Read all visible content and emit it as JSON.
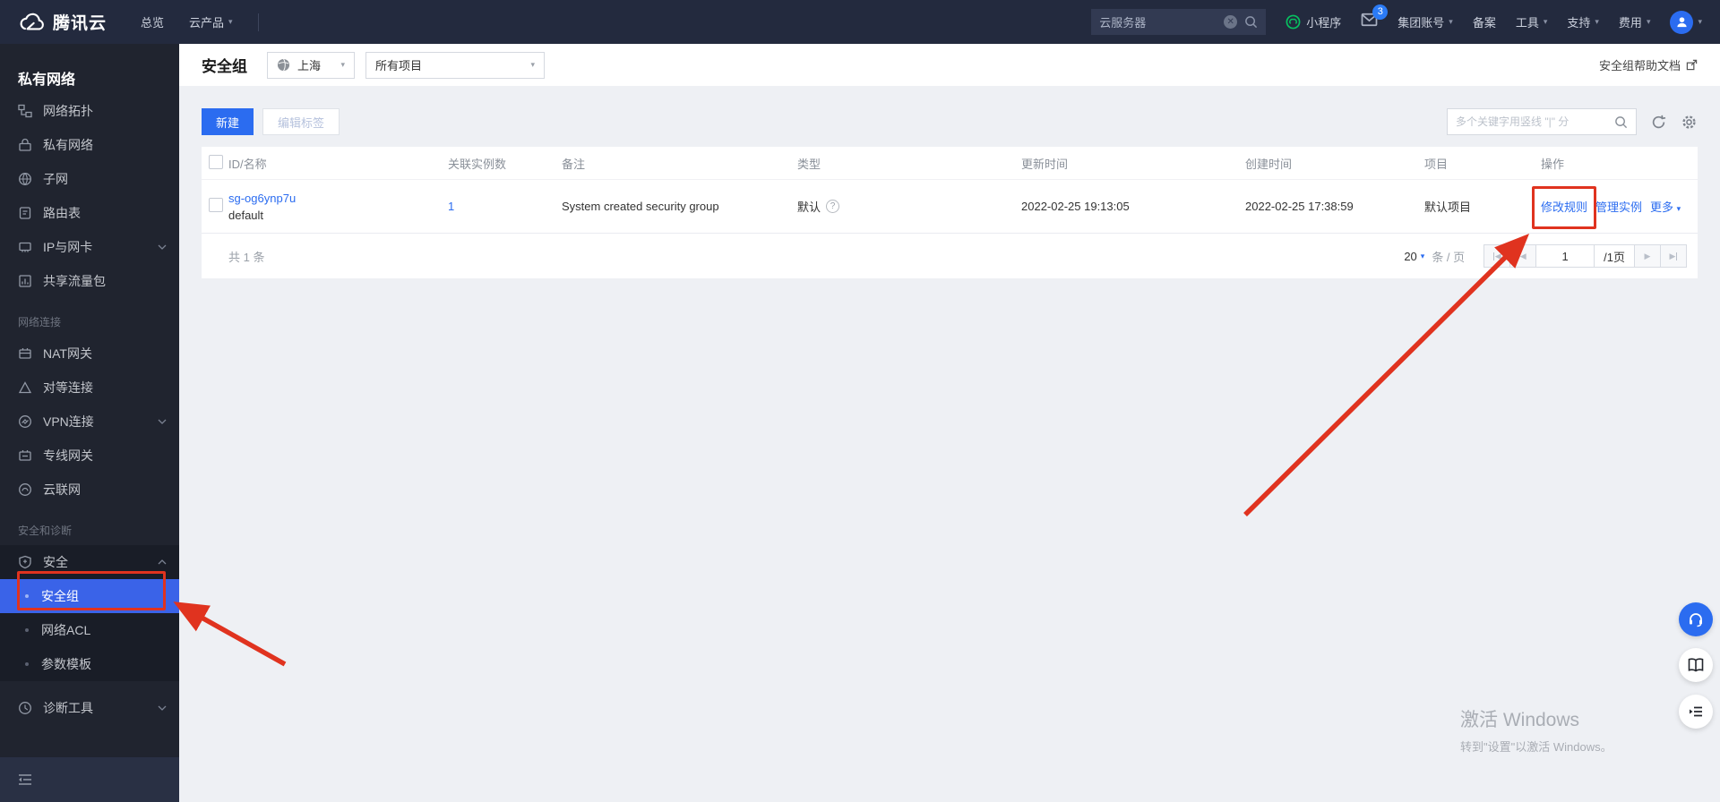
{
  "colors": {
    "accent_blue": "#2b6cf0",
    "sidebar_active_blue": "#3a63e8",
    "annotation_red": "#e0331f",
    "topbar_bg": "#232a3e",
    "sidebar_bg": "#20242f",
    "page_bg": "#eef0f4",
    "miniprogram_green": "#07c160",
    "badge_blue": "#2b7bf6"
  },
  "topbar": {
    "logo_text": "腾讯云",
    "nav_overview": "总览",
    "nav_products": "云产品",
    "search_value": "云服务器",
    "miniprogram_label": "小程序",
    "mail_badge": "3",
    "group_account_label": "集团账号",
    "beian_label": "备案",
    "tools_label": "工具",
    "support_label": "支持",
    "billing_label": "费用"
  },
  "sidebar": {
    "title": "私有网络",
    "sections": {
      "network": "网络连接",
      "security": "安全和诊断"
    },
    "items": [
      {
        "label": "网络拓扑"
      },
      {
        "label": "私有网络"
      },
      {
        "label": "子网"
      },
      {
        "label": "路由表"
      },
      {
        "label": "IP与网卡"
      },
      {
        "label": "共享流量包"
      },
      {
        "label": "NAT网关"
      },
      {
        "label": "对等连接"
      },
      {
        "label": "VPN连接"
      },
      {
        "label": "专线网关"
      },
      {
        "label": "云联网"
      },
      {
        "label": "安全"
      },
      {
        "label": "安全组"
      },
      {
        "label": "网络ACL"
      },
      {
        "label": "参数模板"
      },
      {
        "label": "诊断工具"
      }
    ]
  },
  "page": {
    "title": "安全组",
    "region": "上海",
    "project_filter": "所有项目",
    "help_link": "安全组帮助文档"
  },
  "toolbar": {
    "create_label": "新建",
    "edit_tags_label": "编辑标签",
    "search_placeholder": "多个关键字用竖线 \"|\" 分"
  },
  "table": {
    "headers": [
      "ID/名称",
      "关联实例数",
      "备注",
      "类型",
      "更新时间",
      "创建时间",
      "项目",
      "操作"
    ],
    "rows": [
      {
        "id": "sg-og6ynp7u",
        "name": "default",
        "instance_count": "1",
        "remark": "System created security group",
        "type": "默认",
        "updated_at": "2022-02-25 19:13:05",
        "created_at": "2022-02-25 17:38:59",
        "project": "默认项目",
        "actions": [
          "修改规则",
          "管理实例",
          "更多"
        ]
      }
    ],
    "total_text": "共 1 条"
  },
  "pagination": {
    "page_size": "20",
    "unit": "条 / 页",
    "current_page": "1",
    "total_pages": "/1页"
  },
  "watermark": {
    "line1": "激活 Windows",
    "line2": "转到\"设置\"以激活 Windows。"
  }
}
